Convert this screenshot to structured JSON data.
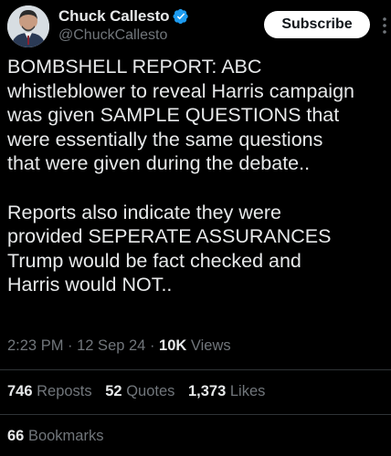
{
  "author": {
    "display_name": "Chuck Callesto",
    "handle": "@ChuckCallesto",
    "verified_icon": "verified-badge-icon",
    "avatar_icon": "profile-photo"
  },
  "actions": {
    "subscribe_label": "Subscribe",
    "more_icon": "more-options-icon"
  },
  "tweet": {
    "text": "BOMBSHELL REPORT: ABC\nwhistleblower to reveal Harris campaign\nwas given SAMPLE QUESTIONS that\nwere essentially the same questions\nthat were given during the debate..\n\nReports also indicate they were\nprovided SEPERATE ASSURANCES\nTrump would be fact checked and\nHarris would NOT..",
    "time": "2:23 PM",
    "sep": " · ",
    "date": "12 Sep 24",
    "views_count": "10K",
    "views_label": " Views"
  },
  "stats": {
    "reposts_count": "746",
    "reposts_label": " Reposts",
    "quotes_count": "52",
    "quotes_label": " Quotes",
    "likes_count": "1,373",
    "likes_label": " Likes",
    "bookmarks_count": "66",
    "bookmarks_label": " Bookmarks"
  },
  "colors": {
    "background": "#000000",
    "text_primary": "#e7e9ea",
    "text_secondary": "#71767b",
    "verified_blue": "#1d9bf0",
    "divider": "#2f3336",
    "button_bg": "#ffffff"
  }
}
